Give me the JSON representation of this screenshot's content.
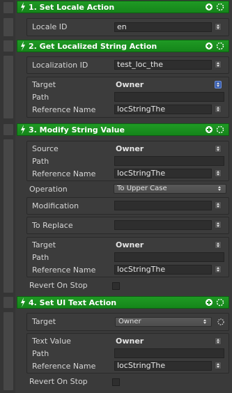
{
  "actions": [
    {
      "title": "1. Set Locale Action",
      "fields": {
        "locale_id_label": "Locale ID",
        "locale_id_value": "en"
      }
    },
    {
      "title": "2. Get Localized String Action",
      "fields": {
        "localization_id_label": "Localization ID",
        "localization_id_value": "test_loc_the",
        "target_label": "Target",
        "target_value": "Owner",
        "path_label": "Path",
        "reference_name_label": "Reference Name",
        "reference_name_value": "locStringThe"
      }
    },
    {
      "title": "3. Modify String Value",
      "fields": {
        "source_label": "Source",
        "source_value": "Owner",
        "path_label": "Path",
        "reference_name_label": "Reference Name",
        "reference_name_value": "locStringThe",
        "operation_label": "Operation",
        "operation_value": "To Upper Case",
        "modification_label": "Modification",
        "to_replace_label": "To Replace",
        "target_label": "Target",
        "target_value": "Owner",
        "path2_label": "Path",
        "reference_name2_label": "Reference Name",
        "reference_name2_value": "locStringThe",
        "revert_on_stop_label": "Revert On Stop"
      }
    },
    {
      "title": "4. Set UI Text Action",
      "fields": {
        "target_label": "Target",
        "target_value": "Owner",
        "text_value_label": "Text Value",
        "text_value_value": "Owner",
        "path_label": "Path",
        "reference_name_label": "Reference Name",
        "reference_name_value": "locStringThe",
        "revert_on_stop_label": "Revert On Stop"
      }
    }
  ],
  "colors": {
    "header_green": "#1f9a24",
    "panel": "#3a3a3a"
  }
}
